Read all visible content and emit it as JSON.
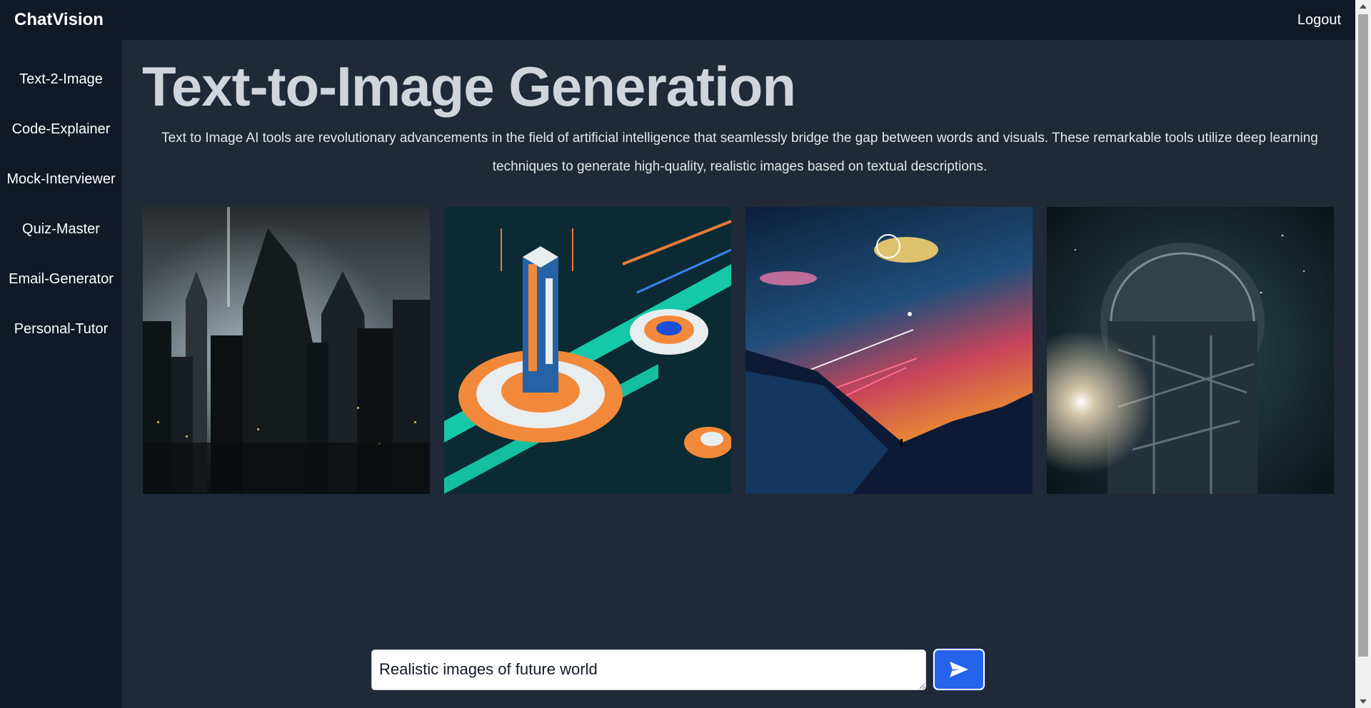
{
  "app": {
    "brand": "ChatVision",
    "logout_label": "Logout"
  },
  "sidebar": {
    "items": [
      {
        "label": "Text-2-Image"
      },
      {
        "label": "Code-Explainer"
      },
      {
        "label": "Mock-Interviewer"
      },
      {
        "label": "Quiz-Master"
      },
      {
        "label": "Email-Generator"
      },
      {
        "label": "Personal-Tutor"
      }
    ]
  },
  "main": {
    "title": "Text-to-Image Generation",
    "description": "Text to Image AI tools are revolutionary advancements in the field of artificial intelligence that seamlessly bridge the gap between words and visuals. These remarkable tools utilize deep learning techniques to generate high-quality, realistic images based on textual descriptions.",
    "images": [
      {
        "subject": "futuristic city skyline"
      },
      {
        "subject": "isometric futuristic tower"
      },
      {
        "subject": "sunset sky with shooting stars"
      },
      {
        "subject": "glowing sphere structure in space"
      }
    ]
  },
  "prompt": {
    "value": "Realistic images of future world",
    "send_icon": "send-icon"
  },
  "colors": {
    "nav_bg": "#111827",
    "main_bg": "#1f2937",
    "accent": "#2563eb"
  }
}
